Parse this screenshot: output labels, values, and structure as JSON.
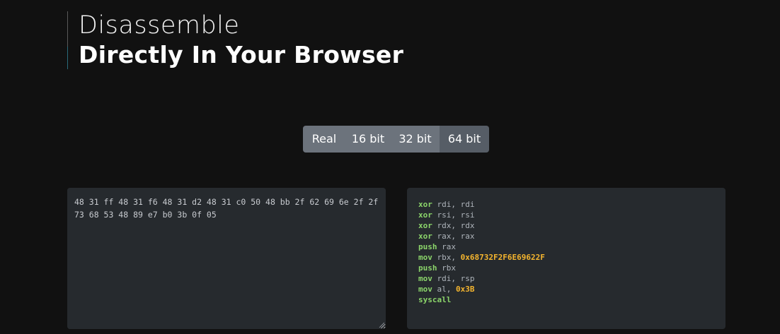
{
  "header": {
    "title_light": "Disassemble",
    "title_bold": "Directly In Your Browser"
  },
  "modes": [
    {
      "label": "Real",
      "width": 0
    },
    {
      "label": "16 bit"
    },
    {
      "label": "32 bit"
    },
    {
      "label": "64 bit",
      "selected": true
    }
  ],
  "input": {
    "value": "48 31 ff 48 31 f6 48 31 d2 48 31 c0 50 48 bb 2f 62 69 6e 2f 2f 73 68 53 48 89 e7 b0 3b 0f 05"
  },
  "output": {
    "lines": [
      {
        "op": "xor",
        "args": "rdi, rdi"
      },
      {
        "op": "xor",
        "args": "rsi, rsi"
      },
      {
        "op": "xor",
        "args": "rdx, rdx"
      },
      {
        "op": "xor",
        "args": "rax, rax"
      },
      {
        "op": "push",
        "args": "rax"
      },
      {
        "op": "mov",
        "args": "rbx, ",
        "imm": "0x68732F2F6E69622F"
      },
      {
        "op": "push",
        "args": "rbx"
      },
      {
        "op": "mov",
        "args": "rdi, rsp"
      },
      {
        "op": "mov",
        "args": "al, ",
        "imm": "0x3B"
      },
      {
        "op": "syscall"
      }
    ]
  },
  "colors": {
    "background": "#111111",
    "panel": "#262a2e",
    "button": "#6c737c",
    "button_active": "#565d66",
    "opcode": "#8bd46a",
    "immediate": "#f5b52e"
  }
}
